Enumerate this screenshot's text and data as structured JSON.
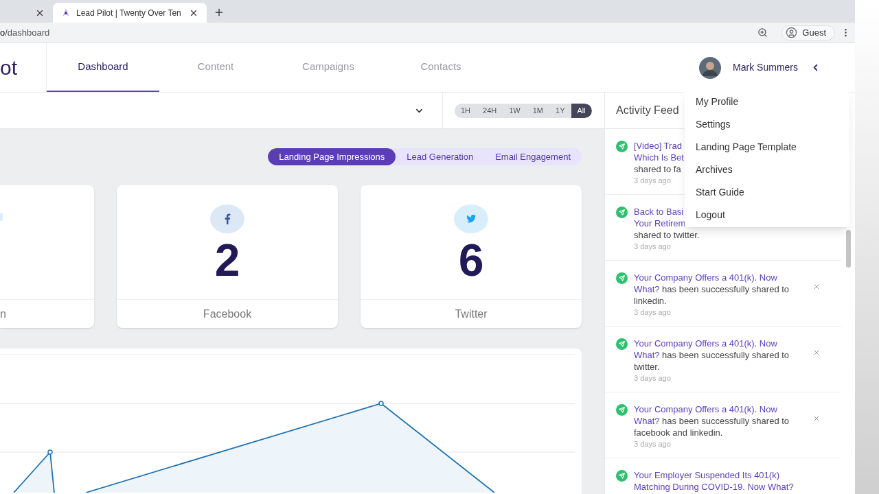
{
  "browser": {
    "tabs": [
      {
        "selected": false
      },
      {
        "title": "Lead Pilot | Twenty Over Ten",
        "selected": true
      }
    ],
    "address": {
      "host_end": "o",
      "path": "/dashboard"
    },
    "profile": "Guest"
  },
  "header": {
    "logo": "ot",
    "nav": [
      {
        "label": "Dashboard",
        "selected": true
      },
      {
        "label": "Content",
        "selected": false
      },
      {
        "label": "Campaigns",
        "selected": false
      },
      {
        "label": "Contacts",
        "selected": false
      }
    ],
    "user": {
      "name": "Mark Summers"
    }
  },
  "user_menu": {
    "expanded": true,
    "items": [
      "My Profile",
      "Settings",
      "Landing Page Template",
      "Archives",
      "Start Guide",
      "Logout"
    ]
  },
  "time_filters": [
    {
      "label": "1H",
      "selected": false
    },
    {
      "label": "24H",
      "selected": false
    },
    {
      "label": "1W",
      "selected": false
    },
    {
      "label": "1M",
      "selected": false
    },
    {
      "label": "1Y",
      "selected": false
    },
    {
      "label": "All",
      "selected": true
    }
  ],
  "segments": [
    {
      "label": "Landing Page Impressions",
      "selected": true
    },
    {
      "label": "Lead Generation",
      "selected": false
    },
    {
      "label": "Email Engagement",
      "selected": false
    }
  ],
  "stats": [
    {
      "kind": "clipped",
      "label": "n"
    },
    {
      "kind": "facebook",
      "count": "2",
      "label": "Facebook"
    },
    {
      "kind": "twitter",
      "count": "6",
      "label": "Twitter"
    }
  ],
  "activity_feed": {
    "title": "Activity Feed",
    "items": [
      {
        "lines": [
          [
            {
              "text": "[Video] Trad",
              "link": true
            }
          ],
          [
            {
              "text": "Which Is Bet",
              "link": true
            }
          ],
          [
            {
              "text": "shared to fa",
              "link": false
            }
          ]
        ],
        "time": "3 days ago",
        "dismissible": false
      },
      {
        "lines": [
          [
            {
              "text": "Back to Basi",
              "link": true
            }
          ],
          [
            {
              "text": "Your Retirem",
              "link": true
            }
          ],
          [
            {
              "text": "shared to twitter.",
              "link": false
            }
          ]
        ],
        "time": "3 days ago",
        "dismissible": false
      },
      {
        "lines": [
          [
            {
              "text": "Your Company Offers a 401(k). Now",
              "link": true
            }
          ],
          [
            {
              "text": "What?",
              "link": true
            },
            {
              "text": "has been successfully shared to",
              "link": false
            }
          ],
          [
            {
              "text": "linkedin.",
              "link": false
            }
          ]
        ],
        "time": "3 days ago",
        "dismissible": true
      },
      {
        "lines": [
          [
            {
              "text": "Your Company Offers a 401(k). Now",
              "link": true
            }
          ],
          [
            {
              "text": "What?",
              "link": true
            },
            {
              "text": "has been successfully shared to",
              "link": false
            }
          ],
          [
            {
              "text": "twitter.",
              "link": false
            }
          ]
        ],
        "time": "3 days ago",
        "dismissible": true
      },
      {
        "lines": [
          [
            {
              "text": "Your Company Offers a 401(k). Now",
              "link": true
            }
          ],
          [
            {
              "text": "What?",
              "link": true
            },
            {
              "text": "has been successfully shared to",
              "link": false
            }
          ],
          [
            {
              "text": "facebook and linkedin.",
              "link": false
            }
          ]
        ],
        "time": "3 days ago",
        "dismissible": true
      },
      {
        "lines": [
          [
            {
              "text": "Your Employer Suspended Its 401(k)",
              "link": true
            }
          ],
          [
            {
              "text": "Matching During COVID-19. Now What?",
              "link": true
            }
          ]
        ],
        "dismissible": false
      }
    ]
  }
}
